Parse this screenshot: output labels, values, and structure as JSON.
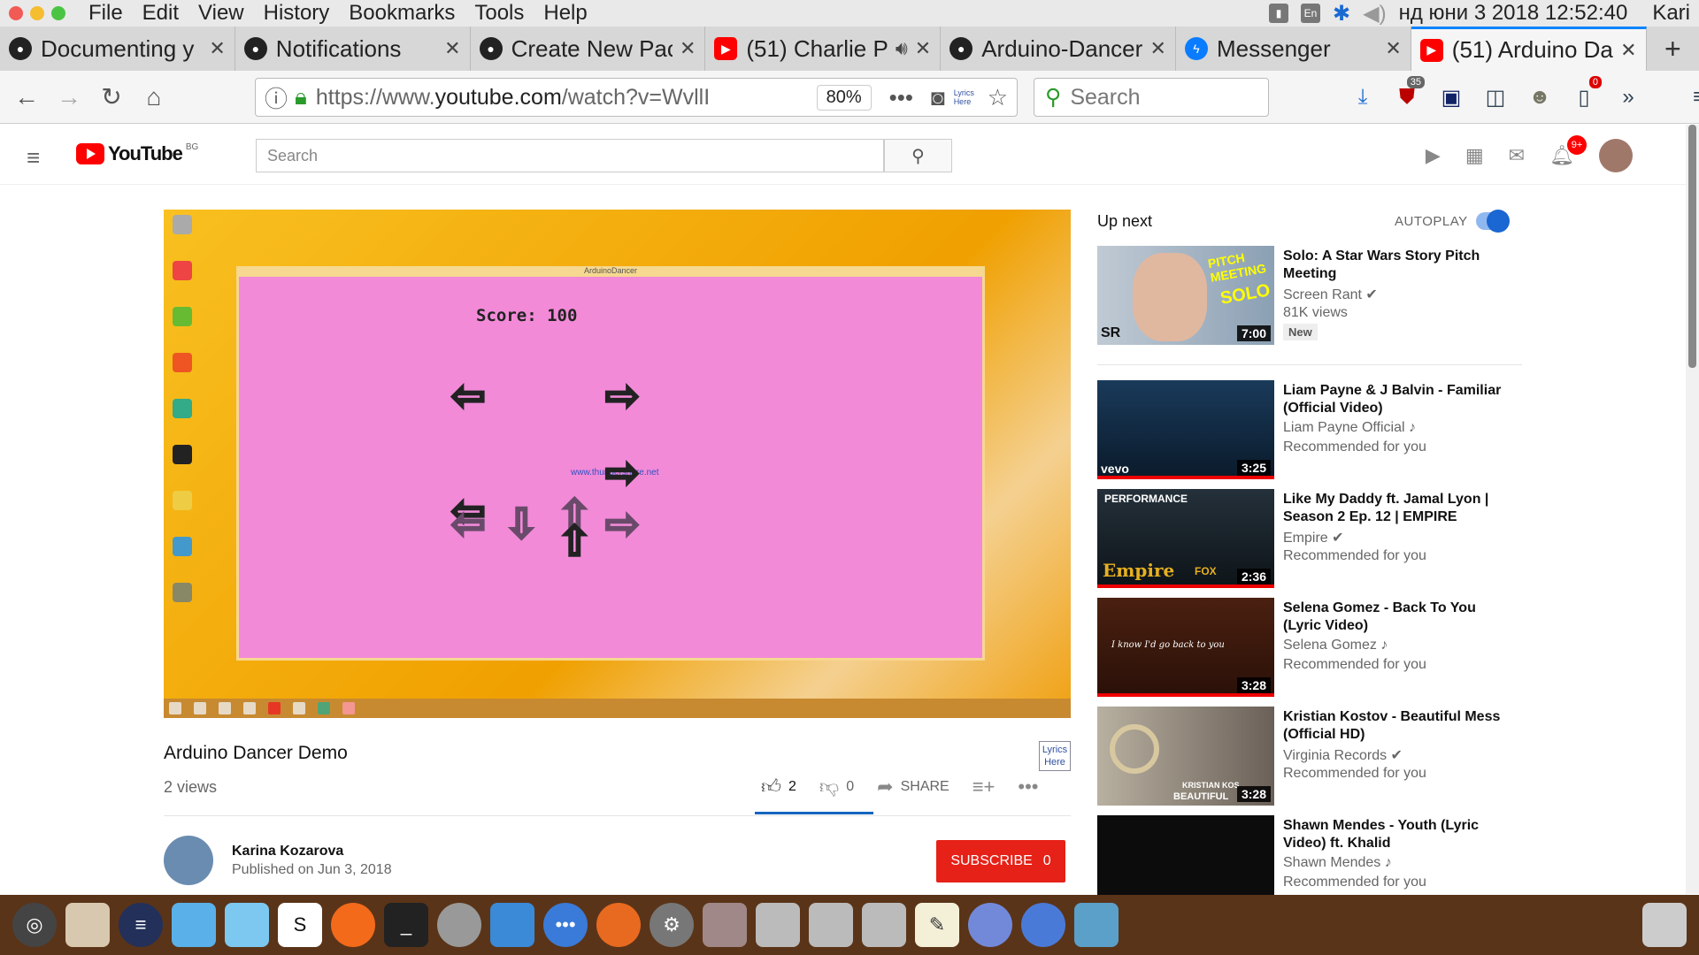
{
  "os_menu": {
    "app": "File",
    "items": [
      "Edit",
      "View",
      "History",
      "Bookmarks",
      "Tools",
      "Help"
    ],
    "status": {
      "lang": "En",
      "clock": "нд юни  3 2018 12:52:40",
      "user": "Kari"
    }
  },
  "tabs": [
    {
      "label": "Documenting y",
      "icon": "github",
      "active": false
    },
    {
      "label": "Notifications",
      "icon": "github",
      "active": false
    },
    {
      "label": "Create New Pac",
      "icon": "github",
      "active": false
    },
    {
      "label": "(51) Charlie P",
      "icon": "youtube",
      "active": false
    },
    {
      "label": "Arduino-Dancer",
      "icon": "github",
      "active": false
    },
    {
      "label": "Messenger",
      "icon": "messenger",
      "active": false
    },
    {
      "label": "(51) Arduino Da",
      "icon": "youtube",
      "active": true
    }
  ],
  "nav": {
    "url_prefix": "https://www.",
    "url_host": "youtube.com",
    "url_rest": "/watch?v=WvllI",
    "zoom": "80%",
    "lyrics": "Lyrics Here",
    "search_placeholder": "Search",
    "ublock_count": "35",
    "badge_count": "0"
  },
  "youtube": {
    "logo": "YouTube",
    "region": "BG",
    "search_placeholder": "Search",
    "notif_count": "9+"
  },
  "video": {
    "window_title": "ArduinoDancer",
    "score": "Score: 100",
    "watermark": "www.thundershare.net",
    "title": "Arduino Dancer Demo",
    "views": "2 views",
    "likes": "2",
    "dislikes": "0",
    "share": "SHARE",
    "lyrics_badge": "Lyrics Here"
  },
  "channel": {
    "name": "Karina Kozarova",
    "published": "Published on Jun 3, 2018",
    "subscribe": "SUBSCRIBE",
    "sub_count": "0"
  },
  "sidebar": {
    "up_next": "Up next",
    "autoplay": "AUTOPLAY",
    "items": [
      {
        "title": "Solo: A Star Wars Story Pitch Meeting",
        "channel": "Screen Rant",
        "meta": "81K views",
        "tag": "New",
        "duration": "7:00"
      },
      {
        "title": "Liam Payne & J Balvin - Familiar (Official Video)",
        "channel": "Liam Payne Official",
        "meta": "Recommended for you",
        "duration": "3:25"
      },
      {
        "title": "Like My Daddy ft. Jamal Lyon | Season 2 Ep. 12 | EMPIRE",
        "channel": "Empire",
        "meta": "Recommended for you",
        "duration": "2:36"
      },
      {
        "title": "Selena Gomez - Back To You (Lyric Video)",
        "channel": "Selena Gomez",
        "meta": "Recommended for you",
        "duration": "3:28"
      },
      {
        "title": "Kristian Kostov - Beautiful Mess (Official HD)",
        "channel": "Virginia Records",
        "meta": "Recommended for you",
        "duration": "3:28"
      },
      {
        "title": "Shawn Mendes - Youth (Lyric Video) ft. Khalid",
        "channel": "Shawn Mendes",
        "meta": "Recommended for you",
        "duration": ""
      }
    ]
  },
  "thumb_text": {
    "solo_1": "PITCH MEETING",
    "solo_2": "SOLO",
    "solo_3": "SR",
    "vevo": "vevo",
    "perf": "PERFORMANCE",
    "empire": "Empire",
    "fox": "FOX",
    "selena": "I know I'd go back to you",
    "kostov_1": "KRISTIAN KOS",
    "kostov_2": "BEAUTIFUL"
  },
  "colors": {
    "yt_red": "#ff0000",
    "accent_blue": "#1a66d2",
    "game_pink": "#f28ad8"
  }
}
